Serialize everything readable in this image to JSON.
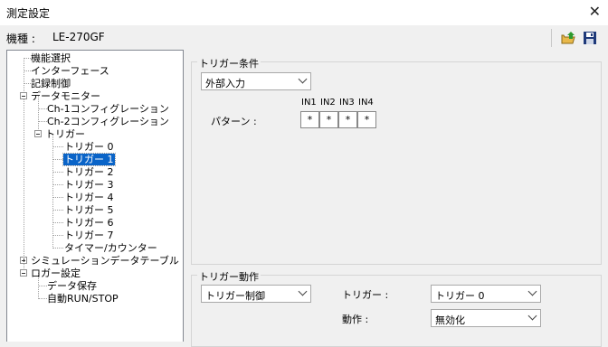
{
  "window": {
    "title": "測定設定"
  },
  "model": {
    "label": "機種 :",
    "value": "LE-270GF"
  },
  "toolbar": {
    "open_icon": "folder-open-icon",
    "save_icon": "floppy-disk-icon"
  },
  "tree": {
    "items": [
      {
        "label": "機能選択"
      },
      {
        "label": "インターフェース"
      },
      {
        "label": "記録制御"
      },
      {
        "label": "データモニター"
      },
      {
        "label": "Ch-1コンフィグレーション"
      },
      {
        "label": "Ch-2コンフィグレーション"
      },
      {
        "label": "トリガー"
      },
      {
        "label": "トリガー 0"
      },
      {
        "label": "トリガー 1"
      },
      {
        "label": "トリガー 2"
      },
      {
        "label": "トリガー 3"
      },
      {
        "label": "トリガー 4"
      },
      {
        "label": "トリガー 5"
      },
      {
        "label": "トリガー 6"
      },
      {
        "label": "トリガー 7"
      },
      {
        "label": "タイマー/カウンター"
      },
      {
        "label": "シミュレーションデータテーブル"
      },
      {
        "label": "ロガー設定"
      },
      {
        "label": "データ保存"
      },
      {
        "label": "自動RUN/STOP"
      }
    ]
  },
  "trigger_condition": {
    "group_label": "トリガー条件",
    "source_value": "外部入力",
    "pattern_label": "パターン :",
    "inputs": [
      "IN1",
      "IN2",
      "IN3",
      "IN4"
    ],
    "values": [
      "*",
      "*",
      "*",
      "*"
    ]
  },
  "trigger_action": {
    "group_label": "トリガー動作",
    "mode_value": "トリガー制御",
    "trigger_label": "トリガー :",
    "trigger_value": "トリガー 0",
    "action_label": "動作 :",
    "action_value": "無効化"
  }
}
